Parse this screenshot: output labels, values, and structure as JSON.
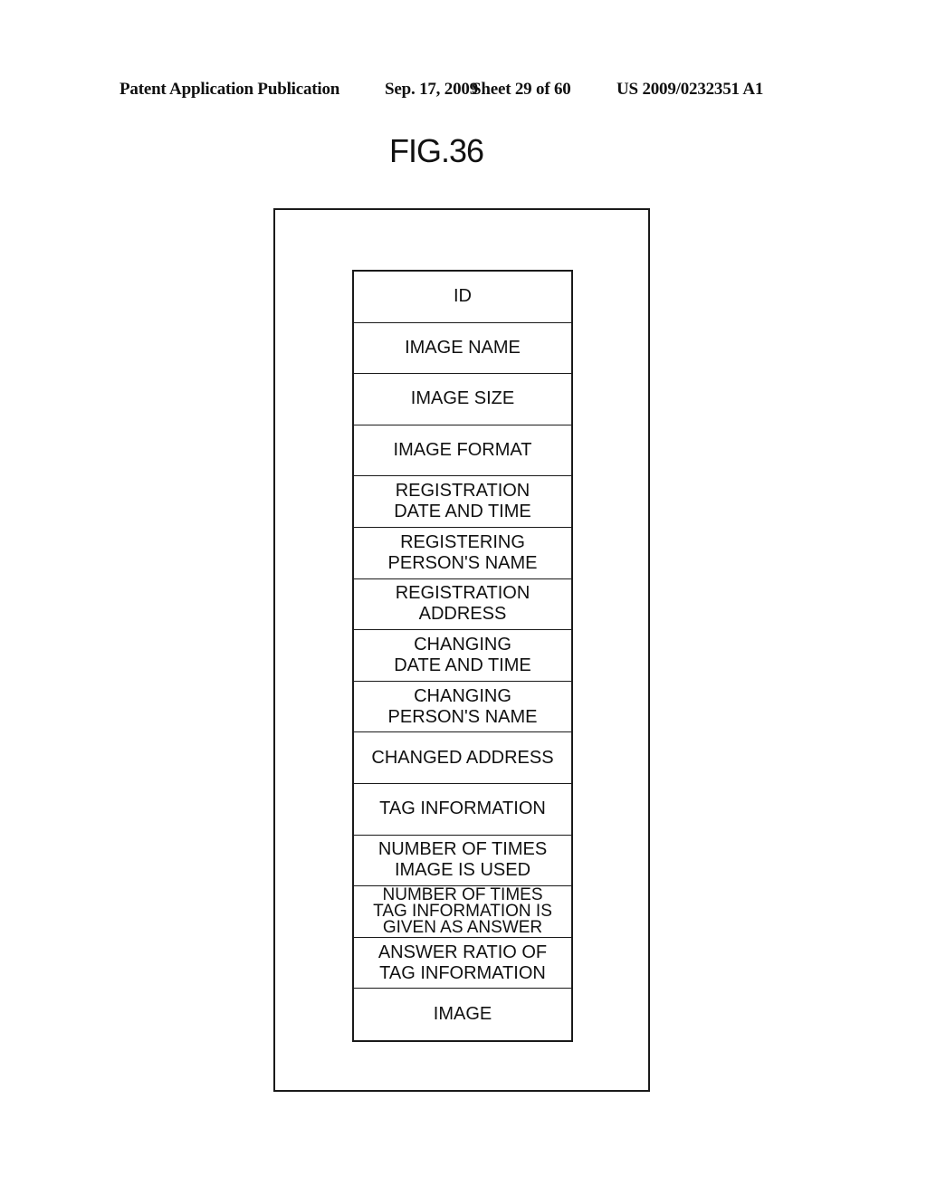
{
  "header": {
    "publication": "Patent Application Publication",
    "date": "Sep. 17, 2009",
    "sheet": "Sheet 29 of 60",
    "number": "US 2009/0232351 A1"
  },
  "figure": {
    "title": "FIG.36"
  },
  "record": {
    "fields": [
      {
        "label": "ID"
      },
      {
        "label": "IMAGE NAME"
      },
      {
        "label": "IMAGE SIZE"
      },
      {
        "label": "IMAGE FORMAT"
      },
      {
        "label": "REGISTRATION\nDATE AND TIME"
      },
      {
        "label": "REGISTERING\nPERSON'S NAME"
      },
      {
        "label": "REGISTRATION\nADDRESS"
      },
      {
        "label": "CHANGING\nDATE AND TIME"
      },
      {
        "label": "CHANGING\nPERSON'S NAME"
      },
      {
        "label": "CHANGED ADDRESS"
      },
      {
        "label": "TAG INFORMATION"
      },
      {
        "label": "NUMBER OF TIMES\nIMAGE IS USED"
      },
      {
        "label": "NUMBER OF TIMES\nTAG INFORMATION IS\nGIVEN AS ANSWER"
      },
      {
        "label": "ANSWER RATIO OF\nTAG INFORMATION"
      },
      {
        "label": "IMAGE"
      }
    ]
  }
}
